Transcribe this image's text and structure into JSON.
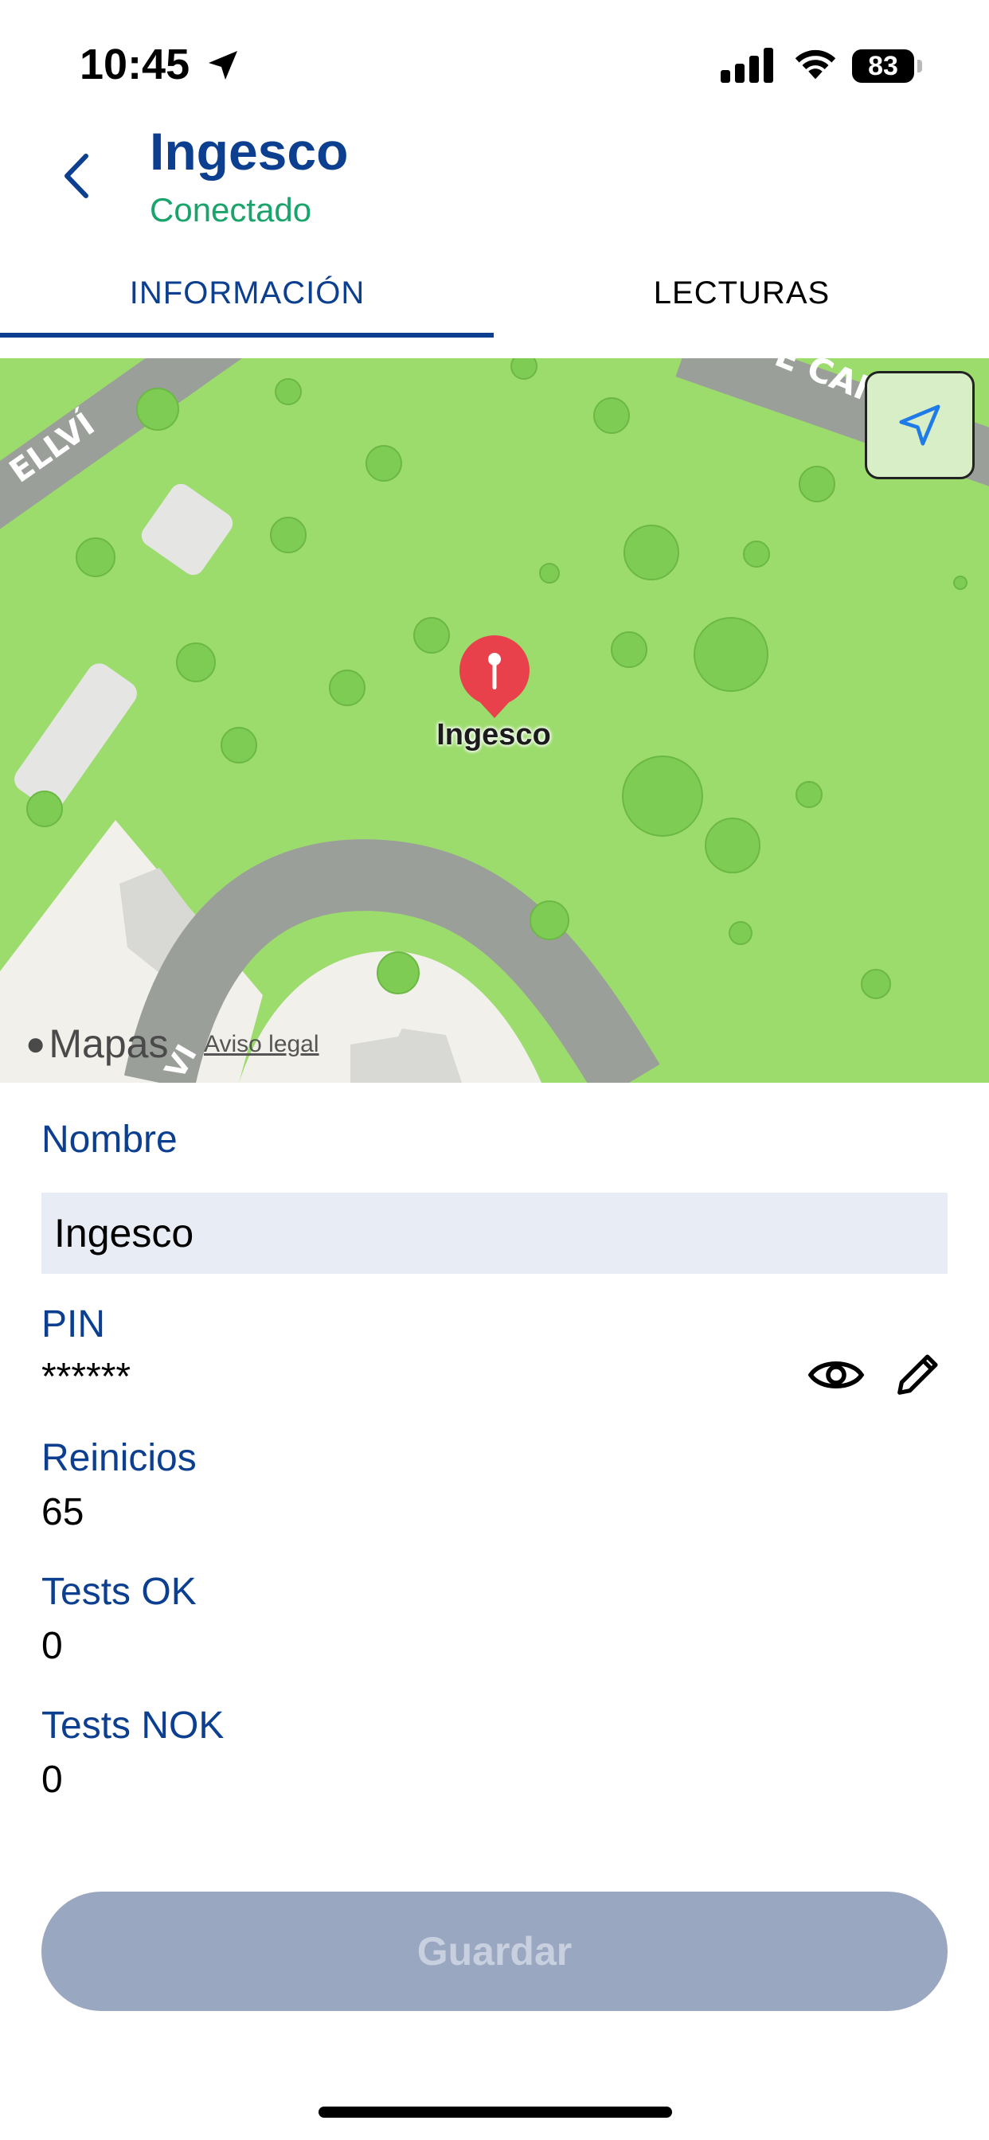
{
  "status_bar": {
    "time": "10:45",
    "battery": "83"
  },
  "header": {
    "title": "Ingesco",
    "subtitle": "Conectado"
  },
  "tabs": [
    {
      "label": "INFORMACIÓN",
      "selected": true
    },
    {
      "label": "LECTURAS",
      "selected": false
    }
  ],
  "map": {
    "street_label_left": "ELLVÍ",
    "street_label_top_right": "E CAN CAS",
    "street_label_bottom": "VI",
    "pin_label": "Ingesco",
    "attribution": "Mapas",
    "legal_link": "Aviso legal"
  },
  "form": {
    "name_label": "Nombre",
    "name_value": "Ingesco",
    "pin_label": "PIN",
    "pin_value": "******",
    "restarts_label": "Reinicios",
    "restarts_value": "65",
    "tests_ok_label": "Tests OK",
    "tests_ok_value": "0",
    "tests_nok_label": "Tests NOK",
    "tests_nok_value": "0"
  },
  "actions": {
    "save_label": "Guardar"
  },
  "colors": {
    "primary": "#0c3f8f",
    "connected": "#1aa36a",
    "map_green": "#9cdc6c",
    "disabled_button": "#9aa7c0"
  }
}
